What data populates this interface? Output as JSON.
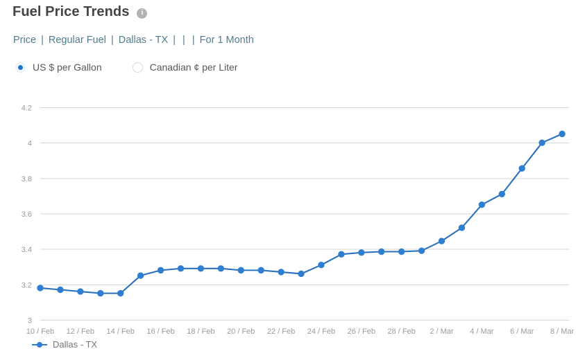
{
  "header": {
    "title": "Fuel Price Trends",
    "info_icon": "info-icon",
    "info_glyph": "i"
  },
  "subtitle": {
    "crumbs": [
      "Price",
      "Regular Fuel",
      "Dallas - TX",
      "",
      "",
      "For 1 Month"
    ],
    "separator": "|"
  },
  "units": {
    "options": [
      {
        "label": "US $ per Gallon",
        "selected": true
      },
      {
        "label": "Canadian ¢ per Liter",
        "selected": false
      }
    ]
  },
  "legend": {
    "position": "bottom-left",
    "entries": [
      {
        "label": "Dallas - TX",
        "color": "#2f7ed0"
      }
    ]
  },
  "colors": {
    "series": "#2f7ed0",
    "series_line": "#2a71bd",
    "grid": "#d6d6d6",
    "tick_text": "#9b9b9b",
    "title_text": "#444444",
    "link_text": "#4f7d8e",
    "radio_accent": "#1976c8"
  },
  "chart_data": {
    "type": "line",
    "title": "Fuel Price Trends",
    "subtitle": "Price | Regular Fuel | Dallas - TX | | | For 1 Month",
    "xlabel": "",
    "ylabel": "",
    "ylim": [
      3,
      4.2
    ],
    "ytick_labels": [
      "3",
      "3.2",
      "3.4",
      "3.6",
      "3.8",
      "4",
      "4.2"
    ],
    "ytick_values": [
      3,
      3.2,
      3.4,
      3.6,
      3.8,
      4,
      4.2
    ],
    "grid": true,
    "grid_axis": "y",
    "xtick_labels": [
      "10 / Feb",
      "12 / Feb",
      "14 / Feb",
      "16 / Feb",
      "18 / Feb",
      "20 / Feb",
      "22 / Feb",
      "24 / Feb",
      "26 / Feb",
      "28 / Feb",
      "2 / Mar",
      "4 / Mar",
      "6 / Mar",
      "8 / Mar"
    ],
    "xtick_indices": [
      0,
      2,
      4,
      6,
      8,
      10,
      12,
      14,
      16,
      18,
      20,
      22,
      24,
      26
    ],
    "x": [
      "10 / Feb",
      "11 / Feb",
      "12 / Feb",
      "13 / Feb",
      "14 / Feb",
      "15 / Feb",
      "16 / Feb",
      "17 / Feb",
      "18 / Feb",
      "19 / Feb",
      "20 / Feb",
      "21 / Feb",
      "22 / Feb",
      "23 / Feb",
      "24 / Feb",
      "25 / Feb",
      "26 / Feb",
      "27 / Feb",
      "28 / Feb",
      "1 / Mar",
      "2 / Mar",
      "3 / Mar",
      "4 / Mar",
      "5 / Mar",
      "6 / Mar",
      "7 / Mar",
      "8 / Mar"
    ],
    "series": [
      {
        "name": "Dallas - TX",
        "color": "#2f7ed0",
        "values": [
          3.18,
          3.17,
          3.16,
          3.15,
          3.15,
          3.25,
          3.28,
          3.29,
          3.29,
          3.29,
          3.28,
          3.28,
          3.27,
          3.26,
          3.31,
          3.37,
          3.38,
          3.385,
          3.385,
          3.39,
          3.445,
          3.52,
          3.65,
          3.71,
          3.855,
          4.0,
          4.05
        ]
      }
    ]
  }
}
